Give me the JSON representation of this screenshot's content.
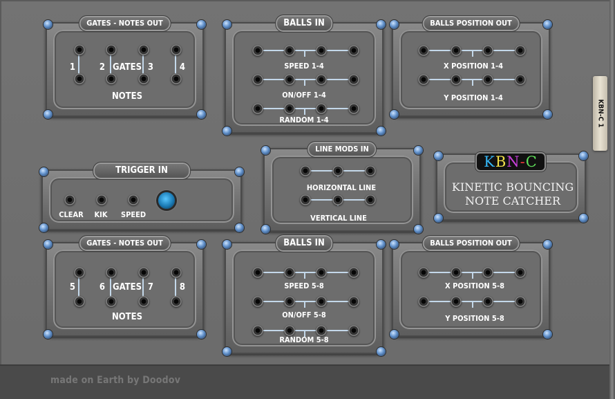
{
  "footer": {
    "text": "made on Earth by Doodov"
  },
  "side_tab": {
    "label": "KBN-C 1"
  },
  "modules": {
    "gates_top": {
      "title": "GATES - NOTES OUT",
      "numbers": [
        "1",
        "2",
        "3",
        "4"
      ],
      "gates_label": "GATES",
      "notes_label": "NOTES"
    },
    "balls_in_top": {
      "title": "BALLS IN",
      "rows": [
        "SPEED 1-4",
        "ON/OFF 1-4",
        "RANDOM 1-4"
      ]
    },
    "balls_pos_top": {
      "title": "BALLS POSITION OUT",
      "rows": [
        "X POSITION 1-4",
        "Y POSITION 1-4"
      ]
    },
    "trigger_in": {
      "title": "TRIGGER IN",
      "labels": [
        "CLEAR",
        "KIK",
        "SPEED"
      ]
    },
    "line_mods": {
      "title": "LINE MODS IN",
      "rows": [
        "HORIZONTAL LINE",
        "VERTICAL LINE"
      ]
    },
    "logo": {
      "short": "KBN-C",
      "line1": "KINETIC BOUNCING",
      "line2": "NOTE CATCHER",
      "letter_colors": [
        "#35b6f5",
        "#f2e14a",
        "#c63fd8",
        "#f03a3a",
        "#5fe05a"
      ]
    },
    "gates_bottom": {
      "title": "GATES - NOTES OUT",
      "numbers": [
        "5",
        "6",
        "7",
        "8"
      ],
      "gates_label": "GATES",
      "notes_label": "NOTES"
    },
    "balls_in_bottom": {
      "title": "BALLS IN",
      "rows": [
        "SPEED 5-8",
        "ON/OFF 5-8",
        "RANDOM 5-8"
      ]
    },
    "balls_pos_bottom": {
      "title": "BALLS POSITION OUT",
      "rows": [
        "X POSITION 5-8",
        "Y POSITION 5-8"
      ]
    }
  }
}
